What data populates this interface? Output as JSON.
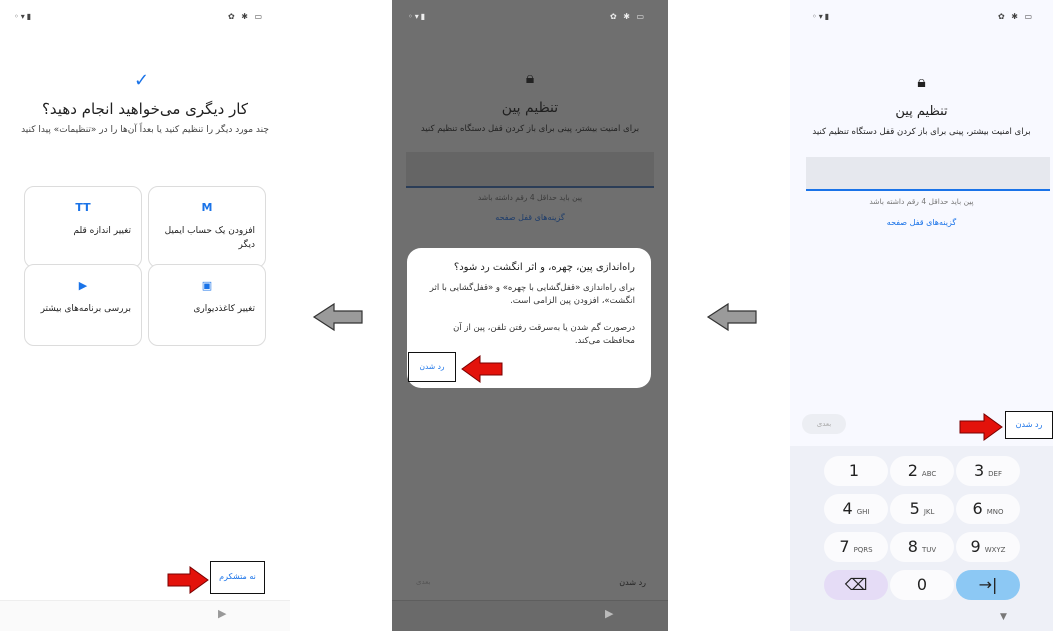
{
  "screen1": {
    "check_icon": "check-icon",
    "title": "کار دیگری می‌خواهید انجام دهید؟",
    "subtitle": "چند مورد دیگر را تنظیم کنید یا بعداً آن‌ها را در «تنظیمات» پیدا کنید",
    "cards": [
      {
        "icon": "gmail-icon",
        "glyph": "M",
        "label": "افزودن یک حساب ایمیل دیگر"
      },
      {
        "icon": "font-size-icon",
        "glyph": "TT",
        "label": "تغییر اندازه قلم"
      },
      {
        "icon": "wallpaper-icon",
        "glyph": "▣",
        "label": "تغییر کاغذدیواری"
      },
      {
        "icon": "play-store-icon",
        "glyph": "▶",
        "label": "بررسی برنامه‌های بیشتر"
      }
    ],
    "no_thanks": "نه متشکرم",
    "accent": "#1a73e8"
  },
  "screen2": {
    "title": "تنظیم پین",
    "subtitle": "برای امنیت بیشتر، پینی برای باز کردن قفل دستگاه تنظیم کنید",
    "hint": "پین باید حداقل 4 رقم داشته باشد",
    "lock_options": "گزینه‌های قفل صفحه",
    "dialog": {
      "title": "راه‌اندازی پین، چهره، و اثر انگشت رد شود؟",
      "body1": "برای راه‌اندازی «قفل‌گشایی با چهره» و «قفل‌گشایی با اثر انگشت»، افزودن پین الزامی است.",
      "body2": "درصورت گم شدن یا به‌سرقت رفتن تلفن، پین از آن محافظت می‌کند.",
      "skip": "رد شدن"
    },
    "bottom_skip": "رد شدن",
    "bottom_next": "بعدی"
  },
  "screen3": {
    "title": "تنظیم پین",
    "subtitle": "برای امنیت بیشتر، پینی برای باز کردن قفل دستگاه تنظیم کنید",
    "hint": "پین باید حداقل 4 رقم داشته باشد",
    "lock_options": "گزینه‌های قفل صفحه",
    "next": "بعدی",
    "skip": "رد شدن",
    "keys": [
      {
        "d": "1",
        "l": ""
      },
      {
        "d": "2",
        "l": "ABC"
      },
      {
        "d": "3",
        "l": "DEF"
      },
      {
        "d": "4",
        "l": "GHI"
      },
      {
        "d": "5",
        "l": "JKL"
      },
      {
        "d": "6",
        "l": "MNO"
      },
      {
        "d": "7",
        "l": "PQRS"
      },
      {
        "d": "8",
        "l": "TUV"
      },
      {
        "d": "9",
        "l": "WXYZ"
      },
      {
        "d": "⌫",
        "l": ""
      },
      {
        "d": "0",
        "l": ""
      },
      {
        "d": "→|",
        "l": ""
      }
    ]
  }
}
